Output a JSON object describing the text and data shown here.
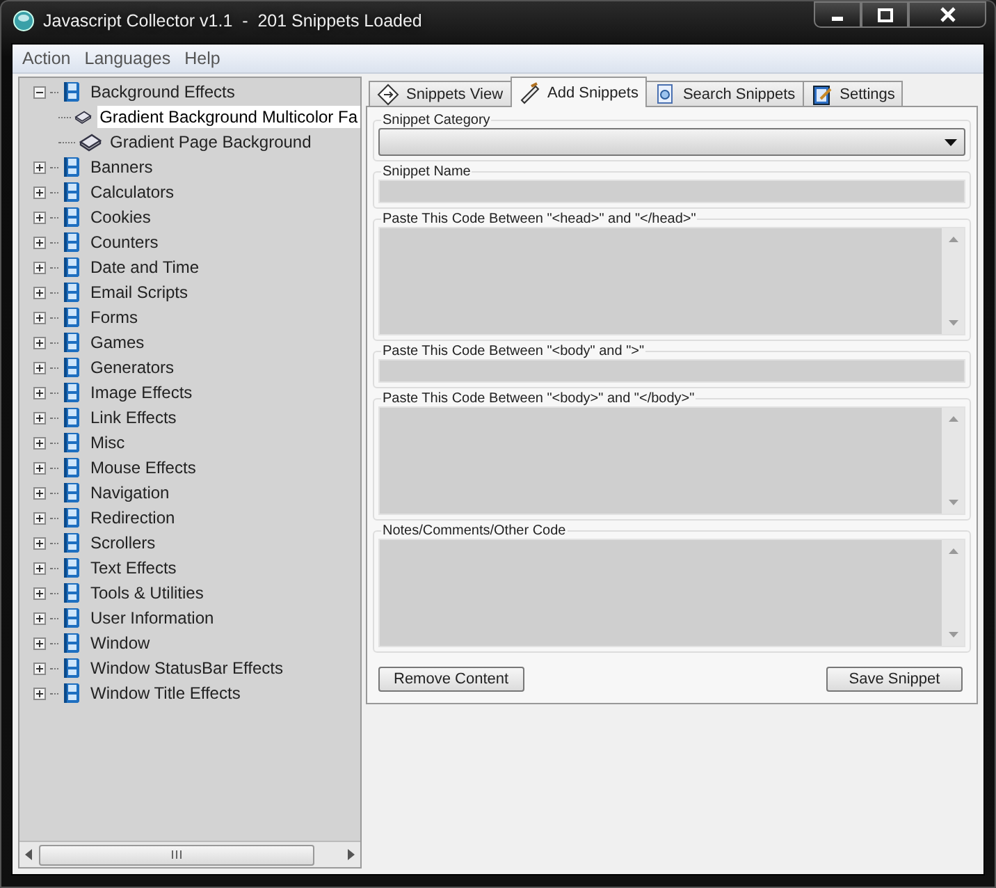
{
  "window": {
    "title": "Javascript Collector v1.1  -  201 Snippets Loaded"
  },
  "menu": [
    "Action",
    "Languages",
    "Help"
  ],
  "tree": [
    {
      "label": "Background Effects",
      "expanded": true,
      "selected": false,
      "children": [
        {
          "label": "Gradient Background Multicolor Fa",
          "selected": true
        },
        {
          "label": "Gradient Page  Background",
          "selected": false
        }
      ]
    },
    {
      "label": "Banners",
      "expanded": false,
      "selected": false
    },
    {
      "label": "Calculators",
      "expanded": false,
      "selected": false
    },
    {
      "label": "Cookies",
      "expanded": false,
      "selected": false
    },
    {
      "label": "Counters",
      "expanded": false,
      "selected": false
    },
    {
      "label": "Date and Time",
      "expanded": false,
      "selected": false
    },
    {
      "label": "Email Scripts",
      "expanded": false,
      "selected": false
    },
    {
      "label": "Forms",
      "expanded": false,
      "selected": false
    },
    {
      "label": "Games",
      "expanded": false,
      "selected": false
    },
    {
      "label": "Generators",
      "expanded": false,
      "selected": false
    },
    {
      "label": "Image Effects",
      "expanded": false,
      "selected": false
    },
    {
      "label": "Link Effects",
      "expanded": false,
      "selected": false
    },
    {
      "label": "Misc",
      "expanded": false,
      "selected": false
    },
    {
      "label": "Mouse Effects",
      "expanded": false,
      "selected": false
    },
    {
      "label": "Navigation",
      "expanded": false,
      "selected": false
    },
    {
      "label": "Redirection",
      "expanded": false,
      "selected": false
    },
    {
      "label": "Scrollers",
      "expanded": false,
      "selected": false
    },
    {
      "label": "Text Effects",
      "expanded": false,
      "selected": false
    },
    {
      "label": "Tools & Utilities",
      "expanded": false,
      "selected": false
    },
    {
      "label": "User Information",
      "expanded": false,
      "selected": false
    },
    {
      "label": "Window",
      "expanded": false,
      "selected": false
    },
    {
      "label": "Window StatusBar Effects",
      "expanded": false,
      "selected": false
    },
    {
      "label": "Window Title Effects",
      "expanded": false,
      "selected": false
    }
  ],
  "tabs": [
    {
      "label": "Snippets View",
      "kind": "view",
      "selected": false
    },
    {
      "label": "Add Snippets",
      "kind": "add",
      "selected": true
    },
    {
      "label": "Search Snippets",
      "kind": "search",
      "selected": false
    },
    {
      "label": "Settings",
      "kind": "settings",
      "selected": false
    }
  ],
  "fields": [
    {
      "kind": "dropdown",
      "label": "Snippet Category"
    },
    {
      "kind": "textbox",
      "label": "Snippet Name"
    },
    {
      "kind": "textarea",
      "label": "Paste This Code Between \"<head>\" and \"</head>\""
    },
    {
      "kind": "textbox",
      "label": "Paste This Code Between \"<body\" and \">\""
    },
    {
      "kind": "textarea",
      "label": "Paste This Code Between \"<body>\" and \"</body>\""
    },
    {
      "kind": "textarea",
      "label": "Notes/Comments/Other Code"
    }
  ],
  "buttons": [
    "Remove Content",
    "Save Snippet"
  ]
}
